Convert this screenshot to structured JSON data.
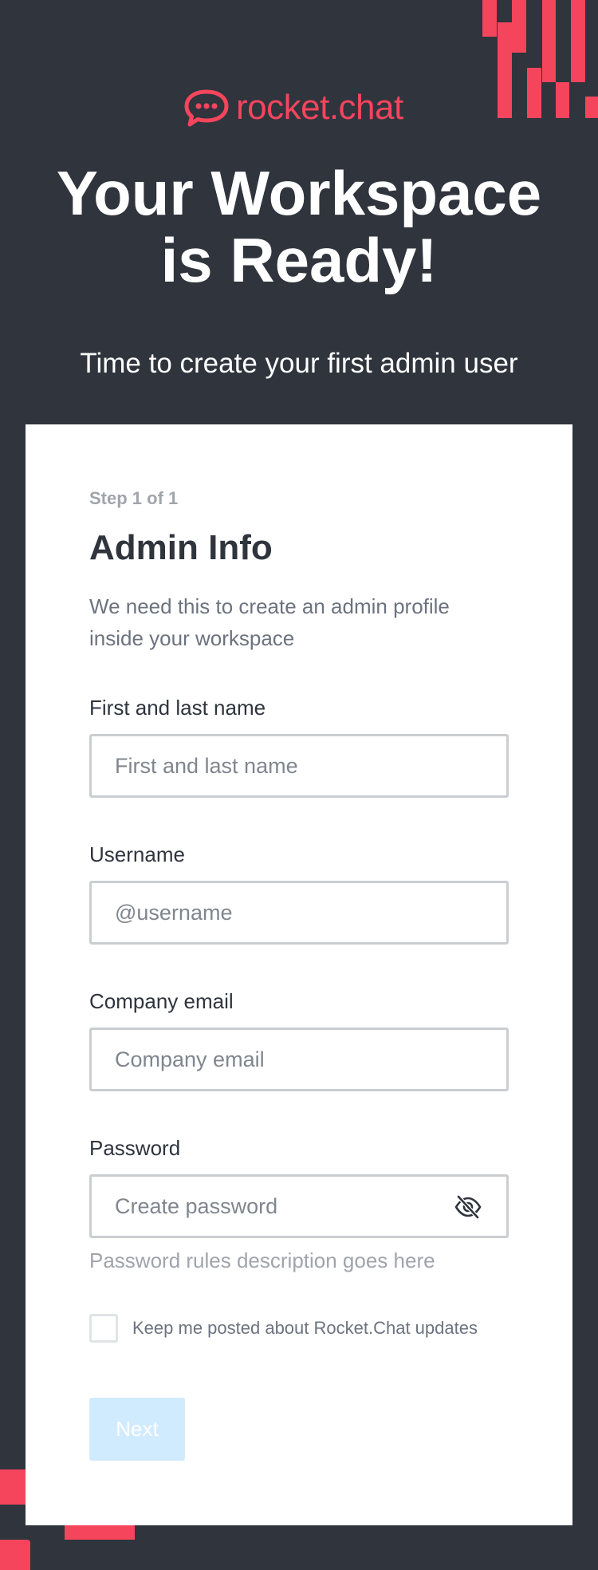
{
  "brand": {
    "logo_text": "rocket.chat",
    "accent_color": "#f5455c",
    "background_color": "#2f343d"
  },
  "hero": {
    "headline_line1": "Your Workspace",
    "headline_line2": "is Ready!",
    "subheadline": "Time to create your first admin user"
  },
  "form": {
    "step": "Step 1 of 1",
    "title": "Admin Info",
    "description": "We need this to create an admin profile inside your workspace",
    "fields": {
      "name": {
        "label": "First and last name",
        "placeholder": "First and last name",
        "value": ""
      },
      "username": {
        "label": "Username",
        "placeholder": "@username",
        "value": ""
      },
      "email": {
        "label": "Company email",
        "placeholder": "Company email",
        "value": ""
      },
      "password": {
        "label": "Password",
        "placeholder": "Create password",
        "value": "",
        "toggle_icon": "eye-slash-icon"
      }
    },
    "password_hint": "Password rules description goes here",
    "newsletter": {
      "label": "Keep me posted about Rocket.Chat updates",
      "checked": false
    },
    "next_label": "Next"
  }
}
